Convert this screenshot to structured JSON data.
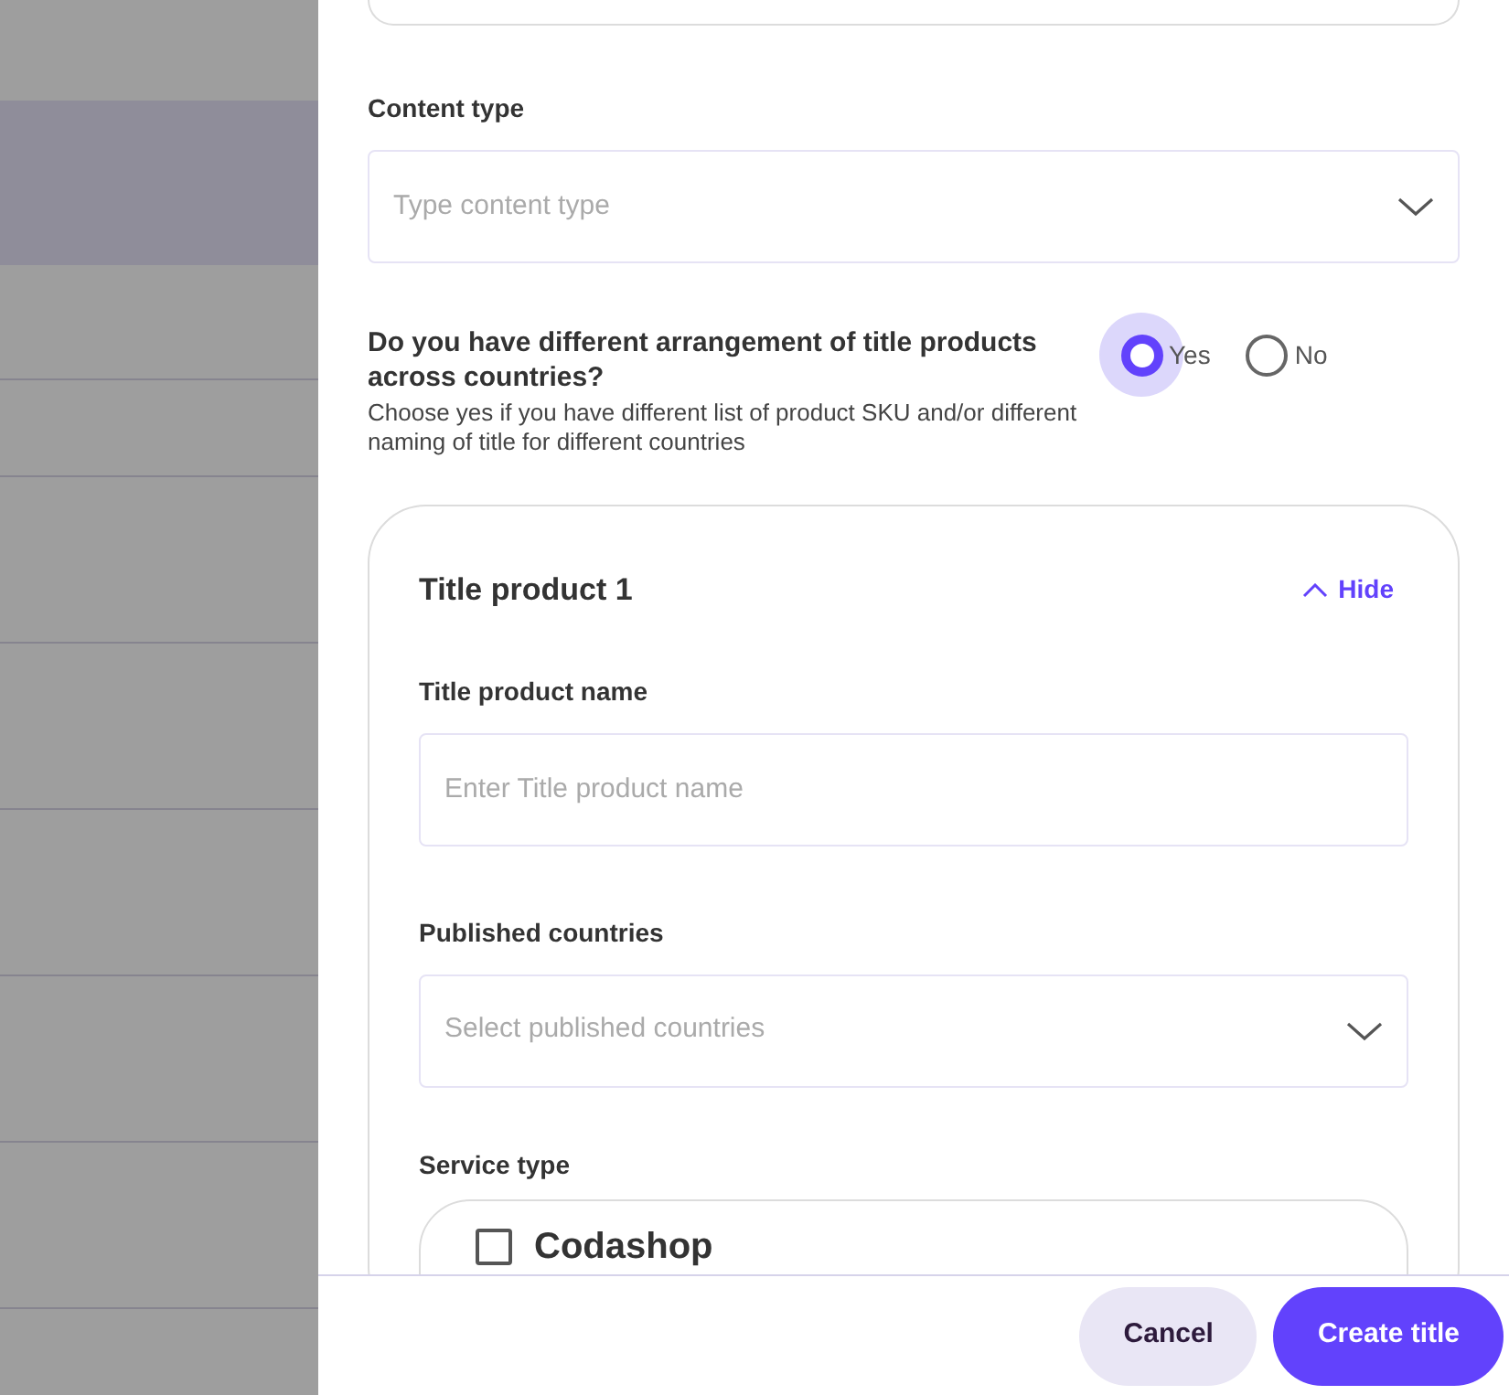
{
  "content_type": {
    "label": "Content type",
    "placeholder": "Type content type"
  },
  "arrangement": {
    "question": "Do you have different arrangement of title products across countries?",
    "hint": "Choose yes if you have different list of product SKU and/or different naming of title for different countries",
    "options": [
      {
        "label": "Yes",
        "selected": true
      },
      {
        "label": "No",
        "selected": false
      }
    ]
  },
  "title_product": {
    "title": "Title product 1",
    "toggle": "Hide",
    "expanded": true,
    "name_field": {
      "label": "Title product name",
      "placeholder": "Enter Title product name"
    },
    "countries_field": {
      "label": "Published countries",
      "placeholder": "Select published countries"
    },
    "service_type": {
      "label": "Service type",
      "options": [
        {
          "label": "Codashop",
          "checked": false
        }
      ]
    }
  },
  "buttons": [
    {
      "label": "Cancel",
      "kind": "secondary"
    },
    {
      "label": "Create title",
      "kind": "primary"
    }
  ]
}
